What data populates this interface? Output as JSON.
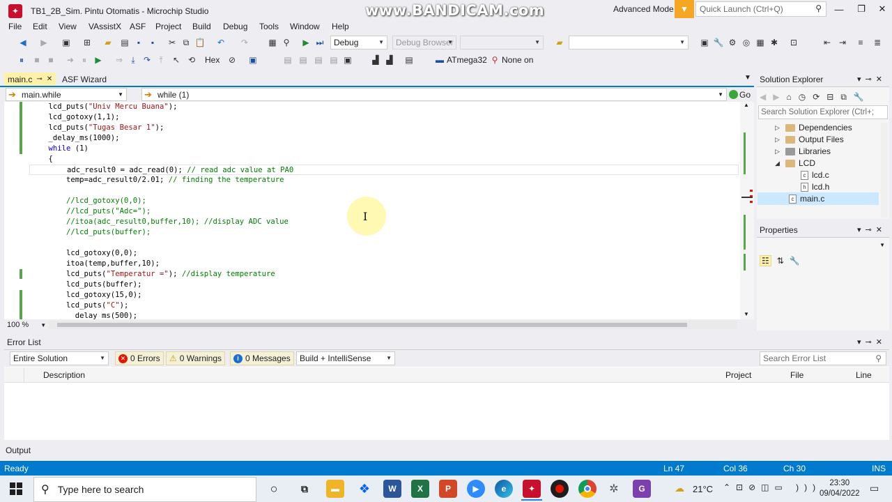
{
  "window": {
    "title": "TB1_2B_Sim. Pintu Otomatis - Microchip Studio",
    "watermark": "www.BANDICAM.com",
    "advanced_mode": "Advanced Mode",
    "quick_launch_placeholder": "Quick Launch (Ctrl+Q)"
  },
  "menu": [
    "File",
    "Edit",
    "View",
    "VAssistX",
    "ASF",
    "Project",
    "Build",
    "Debug",
    "Tools",
    "Window",
    "Help"
  ],
  "toolbar": {
    "config": "Debug",
    "debug_browser": "Debug Browser",
    "hex_label": "Hex",
    "device": "ATmega32",
    "tool": "None on"
  },
  "tabs": {
    "active": "main.c",
    "second": "ASF Wizard"
  },
  "nav": {
    "scope": "main.while",
    "function": "while (1)",
    "go": "Go"
  },
  "code_lines": [
    {
      "pre": "    lcd_puts(",
      "str": "\"Univ Mercu Buana\"",
      "post": ");",
      "cmt": ""
    },
    {
      "pre": "    lcd_gotoxy(1,1);",
      "str": "",
      "post": "",
      "cmt": ""
    },
    {
      "pre": "    lcd_puts(",
      "str": "\"Tugas Besar 1\"",
      "post": ");",
      "cmt": ""
    },
    {
      "pre": "    _delay_ms(1000);",
      "str": "",
      "post": "",
      "cmt": ""
    },
    {
      "pre": "    ",
      "kw": "while",
      "post": " (1)",
      "cmt": ""
    },
    {
      "pre": "    {",
      "str": "",
      "post": "",
      "cmt": ""
    },
    {
      "pre": "        adc_result0 = adc_read(0); ",
      "str": "",
      "post": "",
      "cmt": "// read adc value at PA0"
    },
    {
      "pre": "        temp=adc_result0/2.01; ",
      "str": "",
      "post": "",
      "cmt": "// finding the temperature"
    },
    {
      "pre": "",
      "str": "",
      "post": "",
      "cmt": ""
    },
    {
      "pre": "        ",
      "str": "",
      "post": "",
      "cmt": "//lcd_gotoxy(0,0);"
    },
    {
      "pre": "        ",
      "str": "",
      "post": "",
      "cmt": "//lcd_puts(\"Adc=\");"
    },
    {
      "pre": "        ",
      "str": "",
      "post": "",
      "cmt": "//itoa(adc_result0,buffer,10); //display ADC value"
    },
    {
      "pre": "        ",
      "str": "",
      "post": "",
      "cmt": "//lcd_puts(buffer);"
    },
    {
      "pre": "",
      "str": "",
      "post": "",
      "cmt": ""
    },
    {
      "pre": "        lcd_gotoxy(0,0);",
      "str": "",
      "post": "",
      "cmt": ""
    },
    {
      "pre": "        itoa(temp,buffer,10);",
      "str": "",
      "post": "",
      "cmt": ""
    },
    {
      "pre": "        lcd_puts(",
      "str": "\"Temperatur =\"",
      "post": "); ",
      "cmt": "//display temperature"
    },
    {
      "pre": "        lcd_puts(buffer);",
      "str": "",
      "post": "",
      "cmt": ""
    },
    {
      "pre": "        lcd_gotoxy(15,0);",
      "str": "",
      "post": "",
      "cmt": ""
    },
    {
      "pre": "        lcd_puts(",
      "str": "\"C\"",
      "post": ");",
      "cmt": ""
    },
    {
      "pre": "         _delay_ms(500);",
      "str": "",
      "post": "",
      "cmt": ""
    }
  ],
  "editor": {
    "zoom": "100 %"
  },
  "solution_explorer": {
    "title": "Solution Explorer",
    "search_placeholder": "Search Solution Explorer (Ctrl+;",
    "items": [
      "Dependencies",
      "Output Files",
      "Libraries",
      "LCD",
      "lcd.c",
      "lcd.h",
      "main.c"
    ]
  },
  "properties": {
    "title": "Properties"
  },
  "error_list": {
    "title": "Error List",
    "scope": "Entire Solution",
    "errors": "0 Errors",
    "warnings": "0 Warnings",
    "messages": "0 Messages",
    "build_filter": "Build + IntelliSense",
    "search_placeholder": "Search Error List",
    "columns": [
      "Description",
      "Project",
      "File",
      "Line"
    ]
  },
  "output": {
    "title": "Output"
  },
  "status": {
    "ready": "Ready",
    "line": "Ln 47",
    "col": "Col 36",
    "ch": "Ch 30",
    "ins": "INS"
  },
  "taskbar": {
    "search_placeholder": "Type here to search",
    "weather": "21°C",
    "time": "23:30",
    "date": "09/04/2022"
  },
  "colors": {
    "accent": "#007acc",
    "status_bar": "#007acc",
    "active_tab": "#fff1a8",
    "change_margin": "#57a64a"
  }
}
